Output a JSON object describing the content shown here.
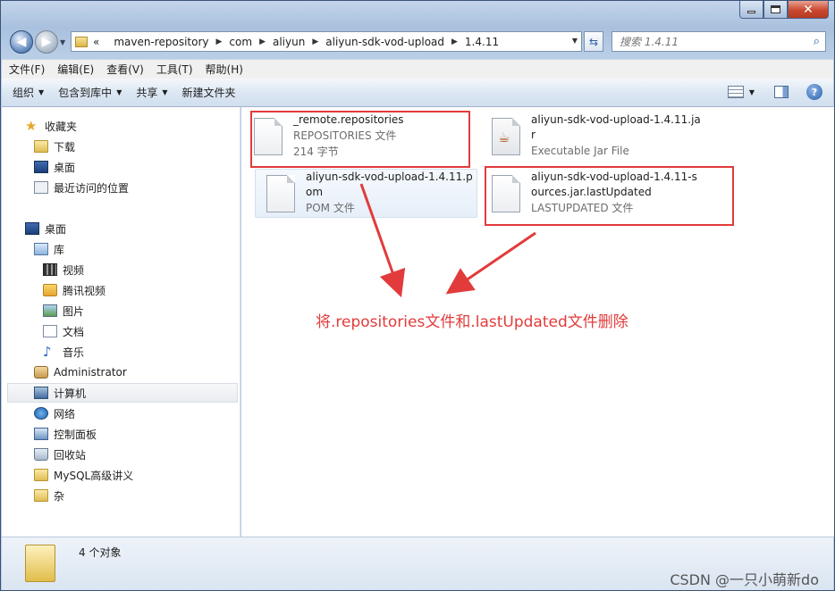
{
  "address": {
    "prefix": "«",
    "crumbs": [
      "maven-repository",
      "com",
      "aliyun",
      "aliyun-sdk-vod-upload",
      "1.4.11"
    ]
  },
  "search": {
    "placeholder": "搜索 1.4.11"
  },
  "menu": [
    "文件(F)",
    "编辑(E)",
    "查看(V)",
    "工具(T)",
    "帮助(H)"
  ],
  "toolbar": {
    "organize": "组织",
    "include_library": "包含到库中",
    "share": "共享",
    "new_folder": "新建文件夹"
  },
  "nav": {
    "favorites": "收藏夹",
    "downloads": "下载",
    "desktop_fav": "桌面",
    "recent": "最近访问的位置",
    "desktop": "桌面",
    "libraries": "库",
    "videos": "视频",
    "tencent_video": "腾讯视频",
    "pictures": "图片",
    "documents": "文档",
    "music": "音乐",
    "administrator": "Administrator",
    "computer": "计算机",
    "network": "网络",
    "control_panel": "控制面板",
    "recycle_bin": "回收站",
    "mysql": "MySQL高级讲义",
    "misc": "杂"
  },
  "files": [
    {
      "name": "_remote.repositories",
      "type": "REPOSITORIES 文件",
      "size": "214 字节"
    },
    {
      "name": "aliyun-sdk-vod-upload-1.4.11.jar",
      "type": "Executable Jar File"
    },
    {
      "name": "aliyun-sdk-vod-upload-1.4.11.pom",
      "type": "POM 文件"
    },
    {
      "name": "aliyun-sdk-vod-upload-1.4.11-sources.jar.lastUpdated",
      "type": "LASTUPDATED 文件"
    }
  ],
  "annotation": "将.repositories文件和.lastUpdated文件删除",
  "status": {
    "count": "4 个对象"
  },
  "watermark": "CSDN @一只小萌新do",
  "colors": {
    "annotation_red": "#e23b3b",
    "window_frame": "#a9c1de"
  }
}
